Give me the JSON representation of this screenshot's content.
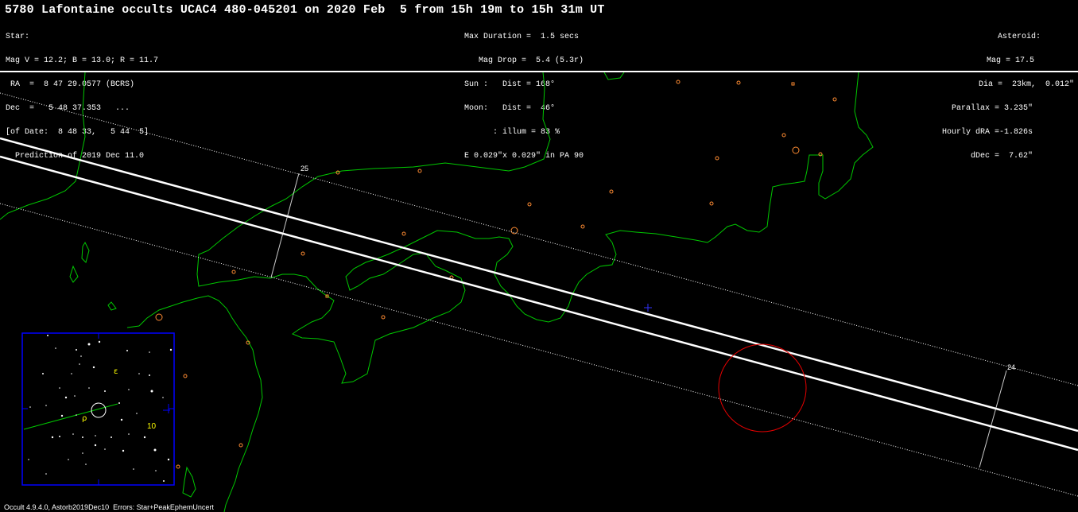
{
  "title": "5780 Lafontaine occults UCAC4 480-045201 on 2020 Feb  5 from 15h 19m to 15h 31m UT",
  "star_block": [
    "Star:",
    "Mag V = 12.2; B = 13.0; R = 11.7",
    " RA  =  8 47 29.0577 (BCRS)",
    "Dec  =   5 48 37.353   ...",
    "[of Date:  8 48 33,   5 44  5]",
    "  Prediction of 2019 Dec 11.0"
  ],
  "mid_block": [
    "Max Duration =  1.5 secs",
    "   Mag Drop =  5.4 (5.3r)",
    "Sun :   Dist = 168°",
    "Moon:   Dist =  46°",
    "      : illum = 83 %",
    "E 0.029\"x 0.029\" in PA 90"
  ],
  "asteroid_block": [
    "Asteroid:",
    "Mag = 17.5",
    "Dia =  23km,  0.012\"",
    "Parallax = 3.235\"",
    "Hourly dRA =-1.826s",
    "dDec =  7.62\""
  ],
  "map": {
    "time_labels": [
      "25",
      "24"
    ],
    "inset_labels": [
      "ε",
      "ρ",
      "10"
    ]
  },
  "colors": {
    "background": "#000000",
    "text": "#ffffff",
    "path_lines": "#ffffff",
    "coastline": "#00c800",
    "city_markers": "#ff8c32",
    "error_circle": "#e60000",
    "center_cross": "#3232ff",
    "inset_frame": "#0000ff",
    "inset_labels": "#ffff00"
  },
  "footer": "Occult 4.9.4.0, Astorb2019Dec10  Errors: Star+PeakEphemUncert"
}
